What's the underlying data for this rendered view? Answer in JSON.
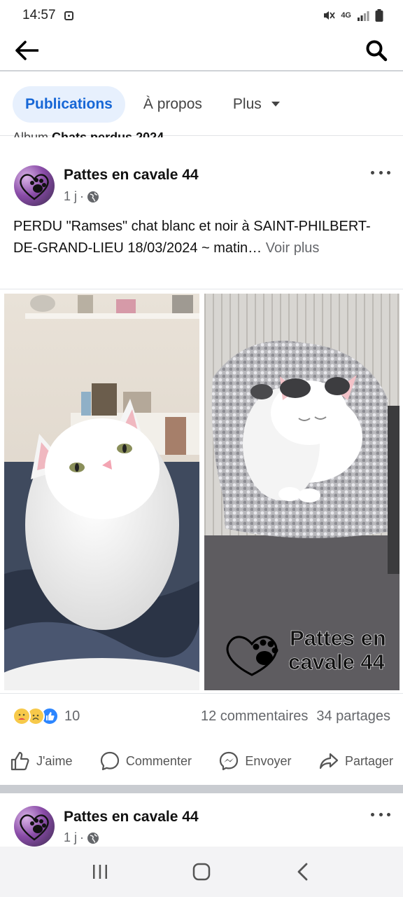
{
  "status_bar": {
    "time": "14:57",
    "network": "4G"
  },
  "tabs": [
    {
      "label": "Publications",
      "active": true
    },
    {
      "label": "À propos",
      "active": false
    },
    {
      "label": "Plus",
      "active": false
    }
  ],
  "album_cut": {
    "prefix": "Album",
    "name": "Chats perdus 2024"
  },
  "post1": {
    "author": "Pattes en cavale 44",
    "time": "1 j",
    "text": "PERDU \"Ramses\" chat blanc et noir à SAINT-PHILBERT-DE-GRAND-LIEU 18/03/2024 ~ matin…",
    "see_more": "Voir plus",
    "watermark_line1": "Pattes en",
    "watermark_line2": "cavale 44",
    "reaction_count": "10",
    "comments": "12 commentaires",
    "shares": "34 partages"
  },
  "actions": {
    "like": "J'aime",
    "comment": "Commenter",
    "send": "Envoyer",
    "share": "Partager"
  },
  "post2": {
    "author": "Pattes en cavale 44",
    "time": "1 j"
  },
  "colors": {
    "accent": "#1767d6",
    "tab_active_bg": "#e7f0fd",
    "muted": "#65676b"
  }
}
